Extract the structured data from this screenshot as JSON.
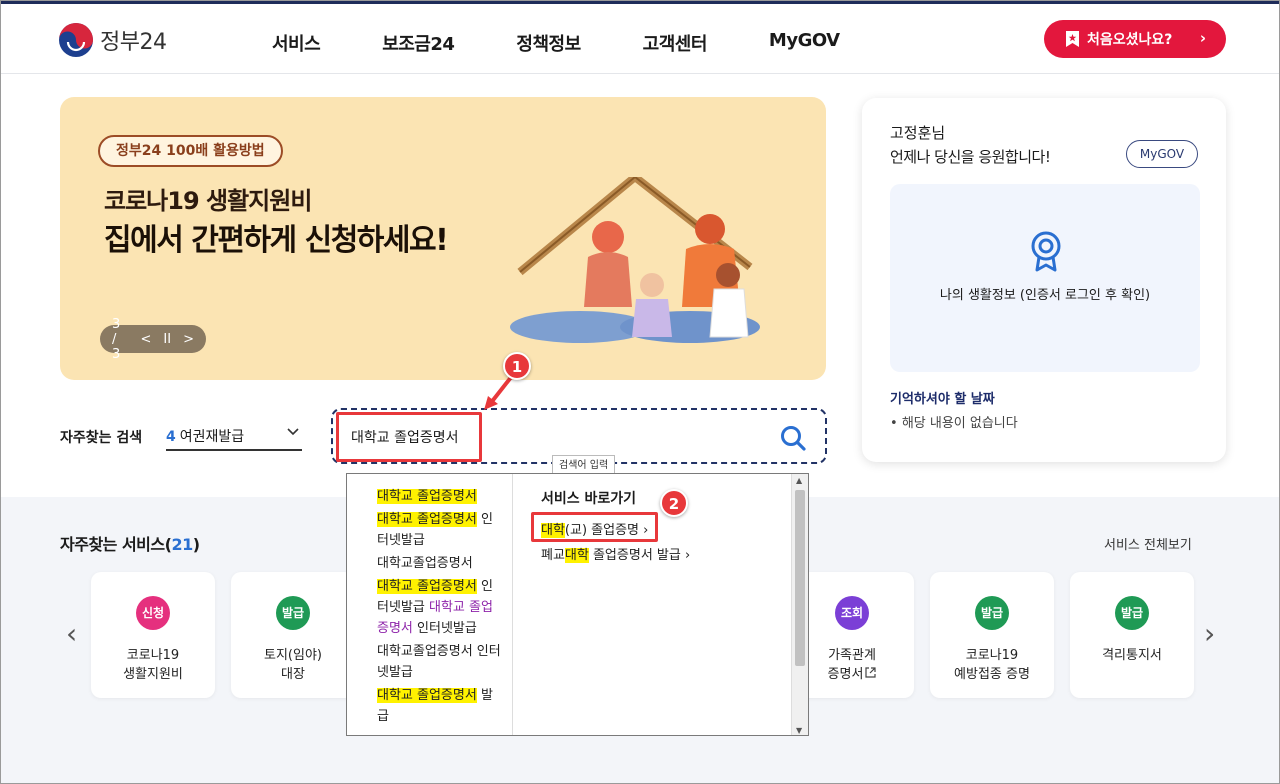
{
  "header": {
    "logo_text": "정부24",
    "nav": [
      "서비스",
      "보조금24",
      "정책정보",
      "고객센터",
      "MyGOV"
    ],
    "first_visit_button": "처음오셨나요?"
  },
  "banner": {
    "pill": "정부24 100배 활용방법",
    "title_line1": "코로나19 생활지원비",
    "title_line2": "집에서 간편하게 신청하세요!",
    "pager": "3 / 3",
    "prev": "<",
    "pause": "II",
    "next": ">"
  },
  "side_card": {
    "greeting_name": "고정훈님",
    "greeting_msg": "언제나 당신을 응원합니다!",
    "mygov_button": "MyGOV",
    "life_info": "나의 생활정보 (인증서 로그인 후 확인)",
    "remember_title": "기억하셔야 할 날짜",
    "remember_empty": "해당 내용이 없습니다"
  },
  "search": {
    "quick_label": "자주찾는 검색",
    "quick_rank": "4",
    "quick_term": "여권재발급",
    "query": "대학교 졸업증명서",
    "tooltip": "검색어 입력"
  },
  "annotations": {
    "badge1": "1",
    "badge2": "2"
  },
  "dropdown": {
    "right_title": "서비스 바로가기",
    "link1_hl": "대학",
    "link1_rest": "(교) 졸업증명",
    "link2_pre": "폐교",
    "link2_hl": "대학",
    "link2_rest": " 졸업증명서 발급",
    "items": {
      "i1_hl": "대학교 졸업증명서",
      "i2_hl": "대학교 졸업증명서",
      "i2_rest": " 인터넷발급",
      "i3": "대학교졸업증명서",
      "i4_hl": "대학교 졸업증명서",
      "i4_mid": " 인터넷발급 ",
      "i4_pk": "대학교 졸업증명서",
      "i4_rest": " 인터넷발급",
      "i5": "대학교졸업증명서 인터넷발급",
      "i6_hl": "대학교 졸업증명서",
      "i6_rest": " 발급"
    }
  },
  "favorites": {
    "title": "자주찾는 서비스(",
    "count": "21",
    "title_end": ")",
    "view_all": "서비스 전체보기",
    "cards": [
      {
        "badge": "신청",
        "name": "코로나19\n생활지원비",
        "color": "#e5307e"
      },
      {
        "badge": "발급",
        "name": "토지(임야)\n대장",
        "color": "#1f9a55"
      },
      {
        "badge": "조회",
        "name": "가족관계\n증명서",
        "color": "#7b3fd6"
      },
      {
        "badge": "발급",
        "name": "코로나19\n예방접종 증명",
        "color": "#1f9a55"
      },
      {
        "badge": "발급",
        "name": "격리통지서",
        "color": "#1f9a55"
      }
    ]
  },
  "colors": {
    "brand_red": "#e3173d",
    "brand_navy": "#1e2c5a",
    "highlight": "#fff200",
    "annotation": "#e8383b"
  }
}
